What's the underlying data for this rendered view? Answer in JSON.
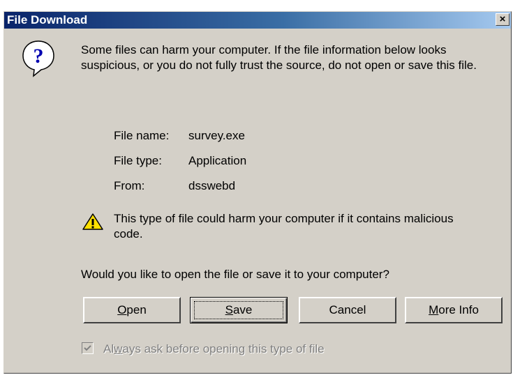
{
  "dialog": {
    "title": "File Download",
    "close_label": "×",
    "intro_text": "Some files can harm your computer. If the file information below looks suspicious, or you do not fully trust the source, do not open or save this file.",
    "file_info": [
      {
        "label": "File name:",
        "value": "survey.exe"
      },
      {
        "label": "File type:",
        "value": "Application"
      },
      {
        "label": "From:",
        "value": "dsswebd"
      }
    ],
    "warning_text": "This type of file could harm your computer if it contains malicious code.",
    "question": "Would you like to open the file or save it to your computer?",
    "buttons": {
      "open": {
        "mnemonic": "O",
        "rest": "pen"
      },
      "save": {
        "mnemonic": "S",
        "rest": "ave"
      },
      "cancel": {
        "label": "Cancel"
      },
      "more_info": {
        "mnemonic": "M",
        "rest": "ore Info"
      }
    },
    "checkbox": {
      "pre": "Al",
      "mnemonic": "w",
      "post": "ays ask before opening this type of file",
      "checked": true,
      "enabled": false
    }
  },
  "icons": {
    "question": "question-icon",
    "warning": "warning-icon"
  },
  "colors": {
    "title_bar_start": "#0a246a",
    "title_bar_end": "#a6caf0",
    "dialog_face": "#d4d0c8"
  }
}
